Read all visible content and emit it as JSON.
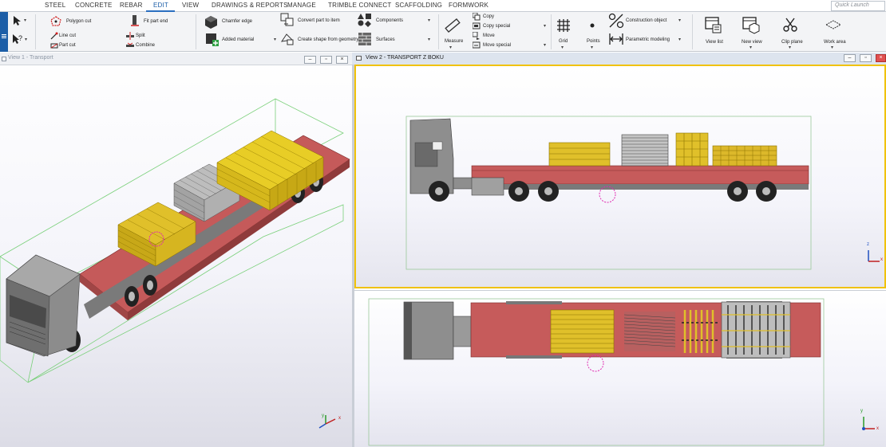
{
  "tabs": [
    "STEEL",
    "CONCRETE",
    "REBAR",
    "EDIT",
    "VIEW",
    "DRAWINGS & REPORTS",
    "MANAGE",
    "TRIMBLE CONNECT",
    "SCAFFOLDING",
    "FORMWORK"
  ],
  "active_tab": "EDIT",
  "quick_launch_placeholder": "Quick Launch",
  "ribbon": {
    "polygon_cut": "Polygon cut",
    "line_cut": "Line cut",
    "part_cut": "Part cut",
    "fit_part_end": "Fit part end",
    "split": "Split",
    "combine": "Combine",
    "chamfer_edge": "Chamfer edge",
    "added_material": "Added material",
    "convert_part": "Convert part to item",
    "create_shape": "Create shape from geometry",
    "components": "Components",
    "surfaces": "Surfaces",
    "measure": "Measure",
    "copy": "Copy",
    "copy_special": "Copy special",
    "move": "Move",
    "move_special": "Move special",
    "grid": "Grid",
    "points": "Points",
    "construction_object": "Construction object",
    "parametric_modeling": "Parametric modeling",
    "view_list": "View list",
    "new_view": "New view",
    "clip_plane": "Clip plane",
    "work_area": "Work area"
  },
  "views": {
    "view1_title": "View 1 - Transport",
    "view2_title": "View 2 - TRANSPORT Z BOKU"
  },
  "axis": {
    "x": "x",
    "y": "y",
    "z": "z"
  },
  "colors": {
    "accent": "#1d5ea7",
    "active_view_border": "#f0c20a",
    "trailer": "#c85c5c",
    "cargo_yellow": "#e6c51c",
    "cab_gray": "#8e8e8e"
  }
}
